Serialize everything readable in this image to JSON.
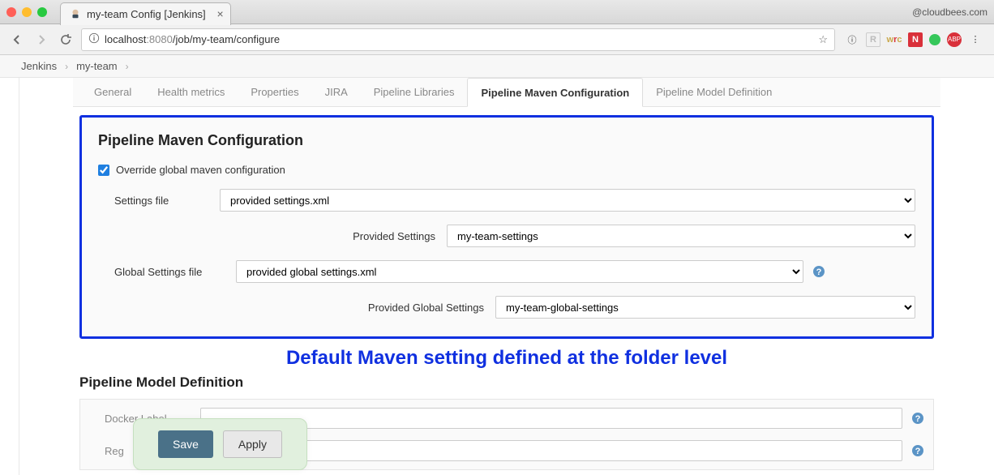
{
  "browser": {
    "tab_title": "my-team Config [Jenkins]",
    "url_host": "localhost",
    "url_port": ":8080",
    "url_path": "/job/my-team/configure",
    "account_text": "@cloudbees.com"
  },
  "breadcrumb": {
    "items": [
      "Jenkins",
      "my-team"
    ]
  },
  "tabs": {
    "general": "General",
    "health": "Health metrics",
    "properties": "Properties",
    "jira": "JIRA",
    "libs": "Pipeline Libraries",
    "maven": "Pipeline Maven Configuration",
    "model": "Pipeline Model Definition"
  },
  "maven": {
    "section_title": "Pipeline Maven Configuration",
    "override_label": "Override global maven configuration",
    "override_checked": true,
    "settings_label": "Settings file",
    "settings_value": "provided settings.xml",
    "provided_settings_label": "Provided Settings",
    "provided_settings_value": "my-team-settings",
    "global_settings_label": "Global Settings file",
    "global_settings_value": "provided global settings.xml",
    "provided_global_label": "Provided Global Settings",
    "provided_global_value": "my-team-global-settings"
  },
  "annotation": "Default Maven setting defined at the folder level",
  "lower": {
    "title": "Pipeline Model Definition",
    "docker_label": "Docker Label",
    "registry_label": "Reg"
  },
  "buttons": {
    "save": "Save",
    "apply": "Apply"
  }
}
